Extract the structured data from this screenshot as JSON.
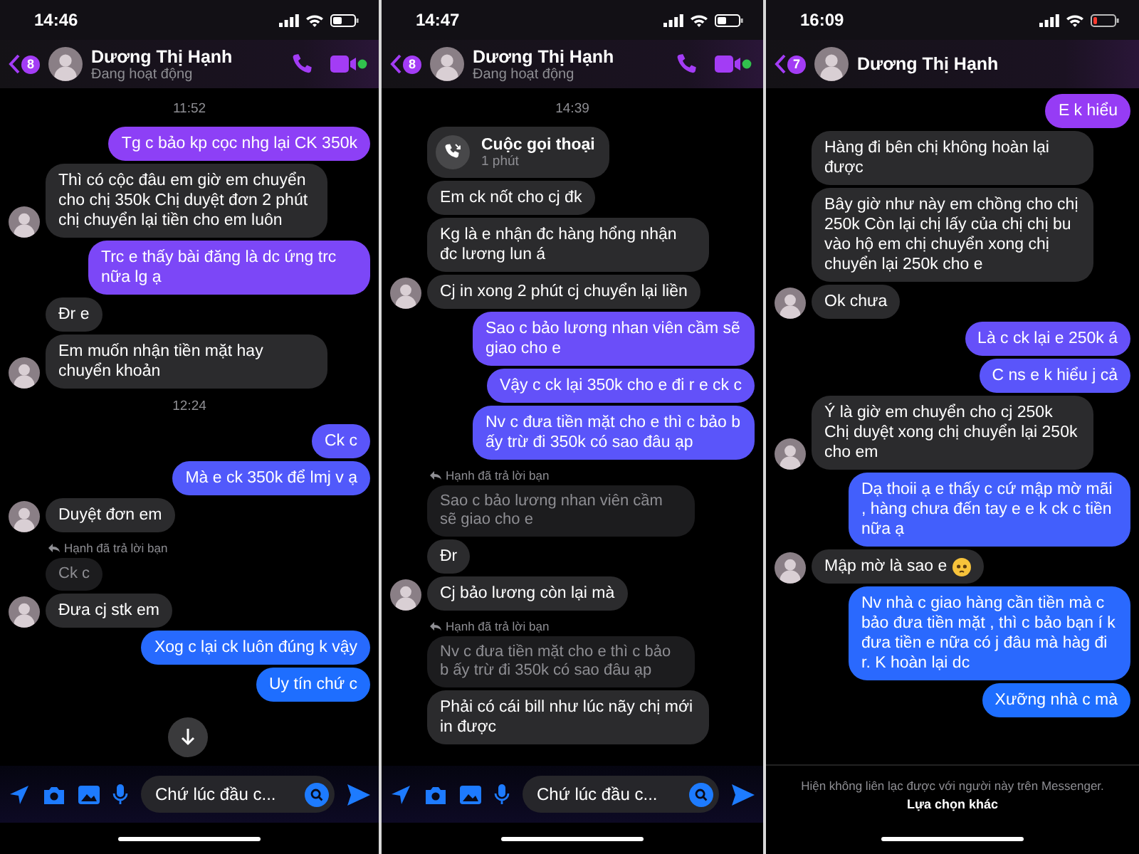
{
  "panels": [
    {
      "status_time": "14:46",
      "battery_low": false,
      "back_count": "8",
      "contact_name": "Dương Thị Hạnh",
      "contact_status": "Đang hoạt động",
      "calls": true,
      "scroll_button": true,
      "messages": [
        {
          "kind": "time",
          "text": "11:52"
        },
        {
          "kind": "out",
          "text": "Tg c bảo kp cọc nhg lại CK 350k"
        },
        {
          "kind": "in",
          "text": "Thì có cộc đâu em giờ em chuyển cho chị 350k Chị duyệt đơn 2 phút chị chuyển lại tiền cho em luôn",
          "avatar": true
        },
        {
          "kind": "out",
          "text": "Trc e thấy bài đăng là dc ứng trc nữa lg ạ"
        },
        {
          "kind": "in",
          "text": "Đr e",
          "avatar": false
        },
        {
          "kind": "in",
          "text": "Em muốn nhận tiền mặt hay chuyển khoản",
          "avatar": true
        },
        {
          "kind": "time",
          "text": "12:24"
        },
        {
          "kind": "out",
          "text": "Ck c"
        },
        {
          "kind": "out",
          "text": "Mà e ck 350k để lmj v ạ"
        },
        {
          "kind": "in",
          "text": "Duyệt đơn em",
          "avatar": true
        },
        {
          "kind": "reply_note",
          "text": "Hạnh đã trả lời bạn"
        },
        {
          "kind": "quoted",
          "text": "Ck c"
        },
        {
          "kind": "in",
          "text": "Đưa cj stk em",
          "avatar": true
        },
        {
          "kind": "out",
          "text": "Xog c lại ck luôn đúng k vậy"
        },
        {
          "kind": "out",
          "text": "Uy tín chứ c"
        }
      ],
      "footer": {
        "kind": "composer",
        "value": "Chứ lúc đầu c..."
      }
    },
    {
      "status_time": "14:47",
      "battery_low": false,
      "back_count": "8",
      "contact_name": "Dương Thị Hạnh",
      "contact_status": "Đang hoạt động",
      "calls": true,
      "scroll_button": false,
      "messages": [
        {
          "kind": "time",
          "text": "14:39"
        },
        {
          "kind": "call",
          "title": "Cuộc gọi thoại",
          "subtitle": "1 phút"
        },
        {
          "kind": "in",
          "text": "Em ck nốt cho cj đk",
          "avatar": false
        },
        {
          "kind": "in",
          "text": "Kg là e nhận đc hàng hổng nhận đc lương lun á",
          "avatar": false
        },
        {
          "kind": "in",
          "text": "Cj in xong 2 phút cj chuyển lại liền",
          "avatar": true
        },
        {
          "kind": "out",
          "text": "Sao c bảo lương nhan viên cầm sẽ giao cho e"
        },
        {
          "kind": "out",
          "text": "Vậy c ck lại 350k cho e đi r e ck c"
        },
        {
          "kind": "out",
          "text": "Nv c đưa tiền mặt cho e thì c bảo b ấy trừ đi 350k có sao đâu ạp"
        },
        {
          "kind": "reply_note",
          "text": "Hạnh đã trả lời bạn"
        },
        {
          "kind": "quoted",
          "text": "Sao c bảo lương nhan viên cầm sẽ giao cho e"
        },
        {
          "kind": "in",
          "text": "Đr",
          "avatar": false
        },
        {
          "kind": "in",
          "text": "Cj bảo lương còn lại mà",
          "avatar": true
        },
        {
          "kind": "reply_note",
          "text": "Hạnh đã trả lời bạn"
        },
        {
          "kind": "quoted",
          "text": "Nv c đưa tiền mặt cho e thì c bảo b ấy trừ đi 350k có sao đâu ạp"
        },
        {
          "kind": "in",
          "text": "Phải có cái bill như lúc nãy chị mới in được",
          "avatar": false
        }
      ],
      "footer": {
        "kind": "composer",
        "value": "Chứ lúc đầu c..."
      }
    },
    {
      "status_time": "16:09",
      "battery_low": true,
      "back_count": "7",
      "contact_name": "Dương Thị Hạnh",
      "calls": false,
      "scroll_button": false,
      "messages": [
        {
          "kind": "out",
          "text": "E k hiểu"
        },
        {
          "kind": "in",
          "text": "Hàng đi bên chị không hoàn lại được",
          "avatar": false
        },
        {
          "kind": "in",
          "text": "Bây giờ như này em chồng cho chị 250k Còn lại chị lấy của chị chị bu vào hộ em chị chuyển xong chị chuyển lại 250k cho e",
          "avatar": false
        },
        {
          "kind": "in",
          "text": "Ok chưa",
          "avatar": true
        },
        {
          "kind": "out",
          "text": "Là c ck lại e 250k á"
        },
        {
          "kind": "out",
          "text": "C ns e k hiểu j cả"
        },
        {
          "kind": "in",
          "text": "Ý là giờ em chuyển cho cj 250k Chị duyệt  xong chị chuyển lại 250k cho em",
          "avatar": true
        },
        {
          "kind": "out",
          "text": "Dạ thoii ạ e thấy c cứ mập mờ mãi , hàng chưa đến tay e e k ck c tiền nữa ạ"
        },
        {
          "kind": "in",
          "text": "Mập mờ là sao e",
          "avatar": true,
          "emoji": true
        },
        {
          "kind": "out",
          "text": "Nv nhà c giao hàng cần tiền mà c bảo đưa tiền mặt , thì c bảo bạn í k đưa tiền e nữa có j đâu mà hàg đi r. K hoàn lại dc"
        },
        {
          "kind": "out",
          "text": "Xưỡng nhà c mà"
        }
      ],
      "footer": {
        "kind": "notice",
        "text": "Hiện không liên lạc được với người này trên Messenger.",
        "action": "Lựa chọn khác"
      }
    }
  ]
}
